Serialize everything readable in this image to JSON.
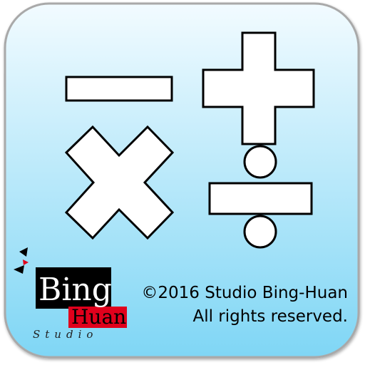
{
  "colors": {
    "background_top": "#f2fbff",
    "background_bottom": "#7fd6f5",
    "border": "#a9a9a9",
    "symbol_fill": "#ffffff",
    "symbol_stroke": "#000000",
    "logo_black": "#000000",
    "logo_red": "#e0001c"
  },
  "icons": {
    "minus": "minus-icon",
    "plus": "plus-icon",
    "times": "multiply-icon",
    "divide": "divide-icon"
  },
  "logo": {
    "word_top": "Bing",
    "word_bottom": "Huan",
    "word_studio": "Studio"
  },
  "copyright": {
    "line1": "©2016 Studio Bing-Huan",
    "line2": "All rights reserved."
  }
}
